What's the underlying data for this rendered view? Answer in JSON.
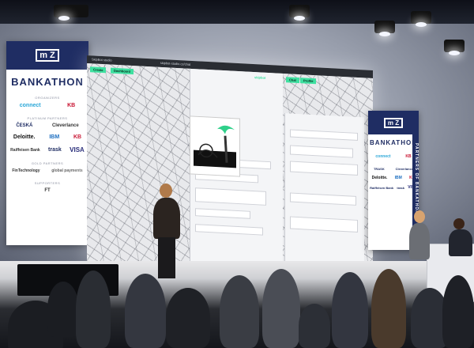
{
  "event": {
    "brand_mark": "m Z",
    "title": "BANKATHON"
  },
  "left_banner": {
    "title": "BANKATHON",
    "categories": {
      "organizer": "Organizers",
      "platinum": "Platinum Partners",
      "gold": "Gold Partners",
      "supporters": "Supporters"
    },
    "sponsors": {
      "row1": [
        "connect",
        "KB"
      ],
      "row2": [
        "ČESKÁ",
        "Cleverlance"
      ],
      "row3": [
        "Deloitte.",
        "IBM",
        "KB"
      ],
      "row4": [
        "Raiffeisen Bank",
        "trask",
        "VISA"
      ],
      "row5": [
        "FinTechnology",
        "global payments"
      ],
      "row6": [
        "FT"
      ]
    }
  },
  "right_banner": {
    "title": "BANKATHON",
    "side_text": "PARTNERS OF BANKATHON",
    "sponsors": {
      "row1": [
        "connect",
        "KB"
      ],
      "row2": [
        "TRASK",
        "Cleverlance"
      ],
      "row3": [
        "Deloitte.",
        "IBM",
        "KB"
      ],
      "row4": [
        "Raiffeisen Bank",
        "trask",
        "VISA"
      ]
    }
  },
  "screen": {
    "window_title": "SkipBot studio",
    "url": "skipbot-studio.cz/chat",
    "left_chips": [
      "Create",
      "Dashboard"
    ],
    "right_chips": [
      "Chat",
      "Profile"
    ],
    "brand_label": "skipbot"
  },
  "colors": {
    "brand_navy": "#1f2d63",
    "accent_green": "#3ee0a0"
  }
}
